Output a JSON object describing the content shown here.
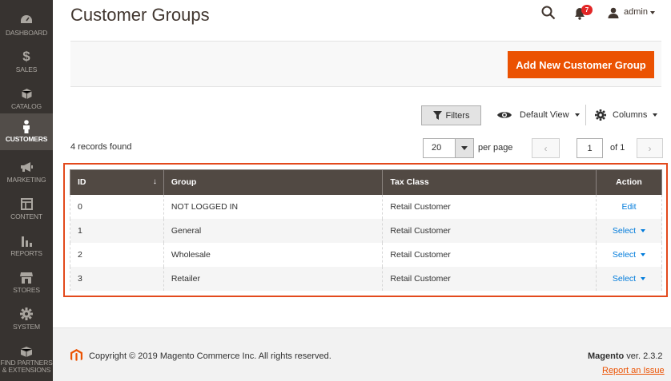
{
  "sidebar": {
    "items": [
      {
        "label": "DASHBOARD",
        "icon": "dashboard-icon"
      },
      {
        "label": "SALES",
        "icon": "dollar-icon"
      },
      {
        "label": "CATALOG",
        "icon": "box-icon"
      },
      {
        "label": "CUSTOMERS",
        "icon": "person-icon",
        "active": true
      },
      {
        "label": "MARKETING",
        "icon": "megaphone-icon"
      },
      {
        "label": "CONTENT",
        "icon": "layout-icon"
      },
      {
        "label": "REPORTS",
        "icon": "bar-chart-icon"
      },
      {
        "label": "STORES",
        "icon": "storefront-icon"
      },
      {
        "label": "SYSTEM",
        "icon": "gear-icon"
      },
      {
        "label": "FIND PARTNERS\n& EXTENSIONS",
        "icon": "extensions-box-icon"
      }
    ]
  },
  "header": {
    "title": "Customer Groups",
    "notifications_count": "7",
    "user": "admin"
  },
  "actions": {
    "add_new_label": "Add New Customer Group"
  },
  "toolbar": {
    "filters_label": "Filters",
    "view_label": "Default View",
    "columns_label": "Columns",
    "records_found": "4 records found",
    "per_page_value": "20",
    "per_page_label": "per page",
    "page_value": "1",
    "page_of": "of 1"
  },
  "grid": {
    "columns": [
      "ID",
      "Group",
      "Tax Class",
      "Action"
    ],
    "rows": [
      {
        "id": "0",
        "group": "NOT LOGGED IN",
        "tax_class": "Retail Customer",
        "action": "Edit"
      },
      {
        "id": "1",
        "group": "General",
        "tax_class": "Retail Customer",
        "action": "Select"
      },
      {
        "id": "2",
        "group": "Wholesale",
        "tax_class": "Retail Customer",
        "action": "Select"
      },
      {
        "id": "3",
        "group": "Retailer",
        "tax_class": "Retail Customer",
        "action": "Select"
      }
    ]
  },
  "footer": {
    "copyright": "Copyright © 2019 Magento Commerce Inc. All rights reserved.",
    "brand": "Magento",
    "version": " ver. 2.3.2",
    "report_link": "Report an Issue"
  },
  "colors": {
    "sidebar_bg": "#373330",
    "accent": "#eb5202",
    "table_header": "#514943",
    "link": "#007bdb",
    "highlight_frame": "#e3491c"
  }
}
